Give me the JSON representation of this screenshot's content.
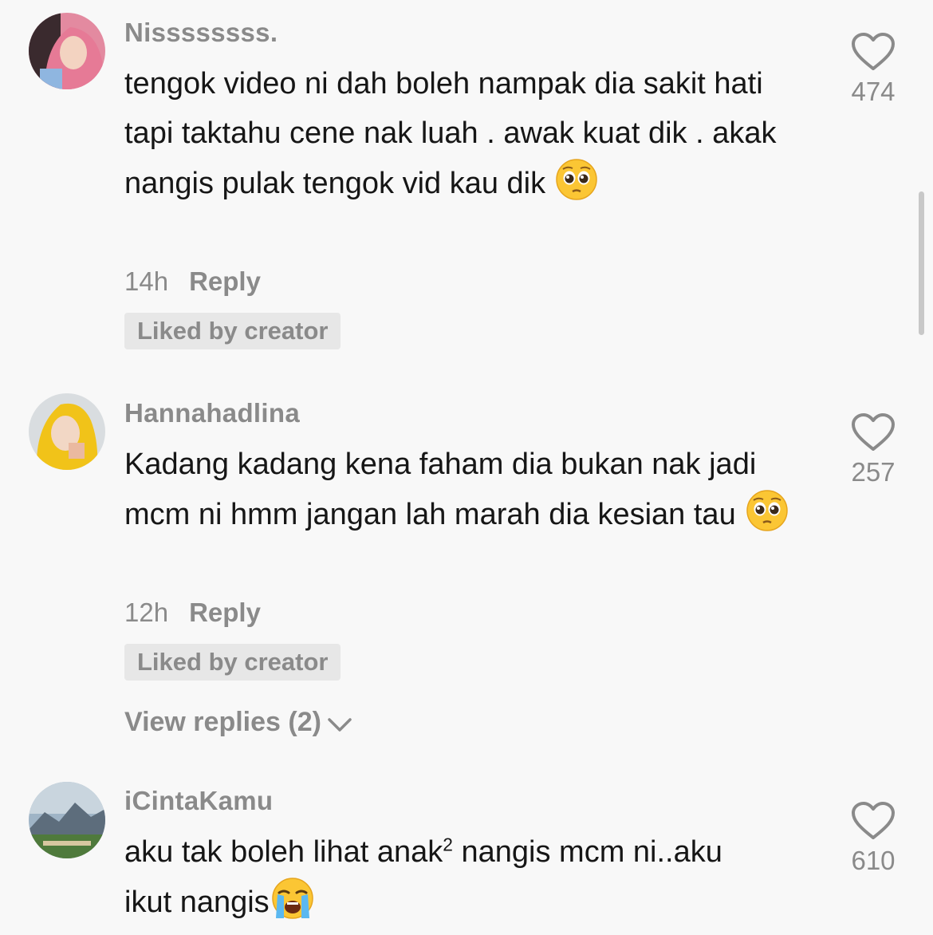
{
  "comments": [
    {
      "username": "Nissssssss.",
      "text": "tengok video ni dah boleh nampak dia sakit hati tapi taktahu cene nak luah . awak kuat dik . akak nangis pulak tengok vid kau dik",
      "emoji": "pleading-face",
      "time": "14h",
      "reply_label": "Reply",
      "badge": "Liked by creator",
      "likes": "474"
    },
    {
      "username": "Hannahadlina",
      "text": "Kadang kadang kena faham dia bukan nak jadi mcm ni hmm jangan lah marah dia kesian tau",
      "emoji": "pleading-face",
      "time": "12h",
      "reply_label": "Reply",
      "badge": "Liked by creator",
      "likes": "257",
      "view_replies": "View replies (2)"
    },
    {
      "username": "iCintaKamu",
      "text_before": "aku tak boleh lihat anak",
      "text_sup": "2",
      "text_after": " nangis mcm ni..aku ikut nangis",
      "emoji": "loudly-crying-face",
      "likes": "610"
    }
  ],
  "colors": {
    "background": "#f8f8f8",
    "text": "#161616",
    "muted": "#8a8a8a",
    "badge_bg": "#e7e7e7"
  }
}
